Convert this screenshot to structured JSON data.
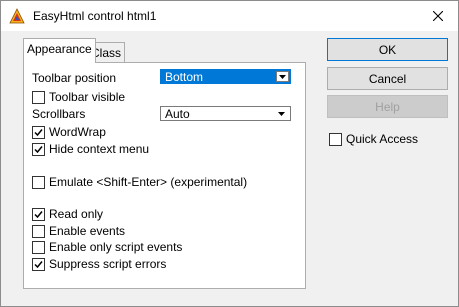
{
  "window": {
    "title": "EasyHtml control html1"
  },
  "tabs": [
    {
      "label": "Appearance"
    },
    {
      "label": "Class"
    }
  ],
  "appearance": {
    "toolbar_position_label": "Toolbar position",
    "toolbar_position_value": "Bottom",
    "toolbar_visible": {
      "label": "Toolbar visible",
      "checked": false
    },
    "scrollbars_label": "Scrollbars",
    "scrollbars_value": "Auto",
    "wordwrap": {
      "label": "WordWrap",
      "checked": true
    },
    "hide_context_menu": {
      "label": "Hide context menu",
      "checked": true
    },
    "emulate_shift_enter": {
      "label": "Emulate <Shift-Enter> (experimental)",
      "checked": false
    },
    "read_only": {
      "label": "Read only",
      "checked": true
    },
    "enable_events": {
      "label": "Enable events",
      "checked": false
    },
    "enable_script_events": {
      "label": "Enable only script events",
      "checked": false
    },
    "suppress_script_errors": {
      "label": "Suppress script errors",
      "checked": true
    }
  },
  "buttons": {
    "ok": "OK",
    "cancel": "Cancel",
    "help": "Help"
  },
  "quick_access": {
    "label": "Quick Access",
    "checked": false
  },
  "colors": {
    "accent": "#0078d7",
    "panel": "#ffffff",
    "dialog": "#f0f0f0"
  }
}
